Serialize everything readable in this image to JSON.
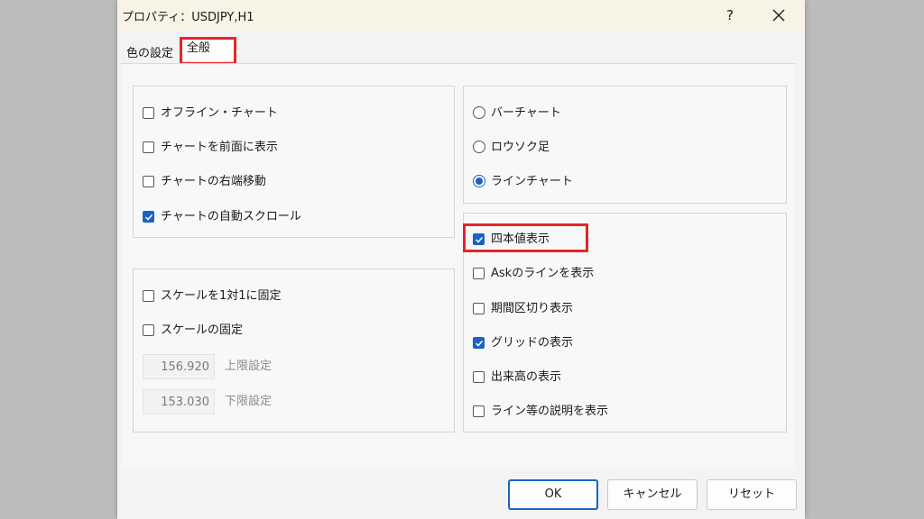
{
  "window": {
    "title": "プロパティ：USDJPY,H1",
    "help_label": "?"
  },
  "tabs": [
    {
      "label": "色の設定",
      "active": false
    },
    {
      "label": "全般",
      "active": true
    }
  ],
  "left_top_group": [
    {
      "label": "オフライン・チャート",
      "checked": false
    },
    {
      "label": "チャートを前面に表示",
      "checked": false
    },
    {
      "label": "チャートの右端移動",
      "checked": false
    },
    {
      "label": "チャートの自動スクロール",
      "checked": true
    }
  ],
  "scale_group": {
    "options": [
      {
        "label": "スケールを1対1に固定",
        "checked": false
      },
      {
        "label": "スケールの固定",
        "checked": false
      }
    ],
    "upper_value": "156.920",
    "upper_label": "上限設定",
    "lower_value": "153.030",
    "lower_label": "下限設定"
  },
  "chart_type_group": [
    {
      "label": "バーチャート",
      "selected": false
    },
    {
      "label": "ロウソク足",
      "selected": false
    },
    {
      "label": "ラインチャート",
      "selected": true
    }
  ],
  "display_group": [
    {
      "label": "四本値表示",
      "checked": true
    },
    {
      "label": "Askのラインを表示",
      "checked": false
    },
    {
      "label": "期間区切り表示",
      "checked": false
    },
    {
      "label": "グリッドの表示",
      "checked": true
    },
    {
      "label": "出来高の表示",
      "checked": false
    },
    {
      "label": "ライン等の説明を表示",
      "checked": false
    }
  ],
  "buttons": {
    "ok": "OK",
    "cancel": "キャンセル",
    "reset": "リセット"
  },
  "colors": {
    "accent": "#1a63c3",
    "highlight": "#e8242a"
  }
}
